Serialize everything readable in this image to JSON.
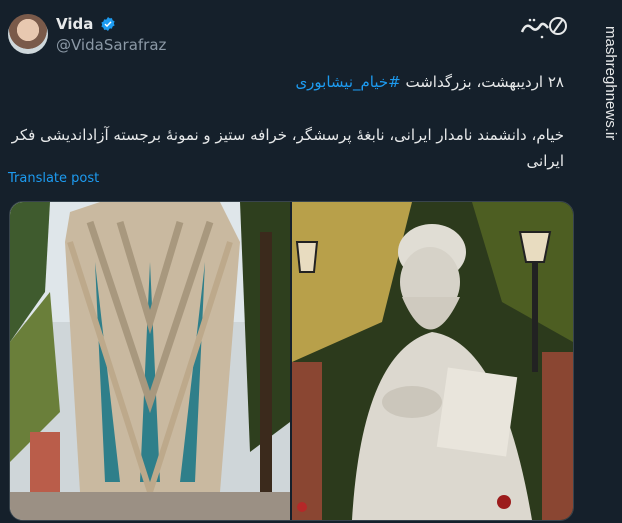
{
  "author": {
    "name": "Vida",
    "handle": "@VidaSarafraz",
    "verified_color": "#1d9bf0"
  },
  "post": {
    "line1_prefix": "۲۸ اردیبهشت، بزرگداشت ",
    "hashtag": "#خیام_نیشابوری",
    "body": "خیام، دانشمند نامدار ایرانی، نابغهٔ پرسشگر، خرافه ستیز و نمونهٔ برجسته آزاداندیشی فکر ایرانی",
    "translate_label": "Translate post"
  },
  "watermark": {
    "site": "mashreghnews.ir",
    "logo_text": "مشرق"
  },
  "media": {
    "left_icon": "tomb-monument-image",
    "right_icon": "statue-image"
  },
  "colors": {
    "background": "#15202b",
    "accent": "#1d9bf0",
    "text": "#e7e9ea",
    "muted": "#8b98a5"
  }
}
